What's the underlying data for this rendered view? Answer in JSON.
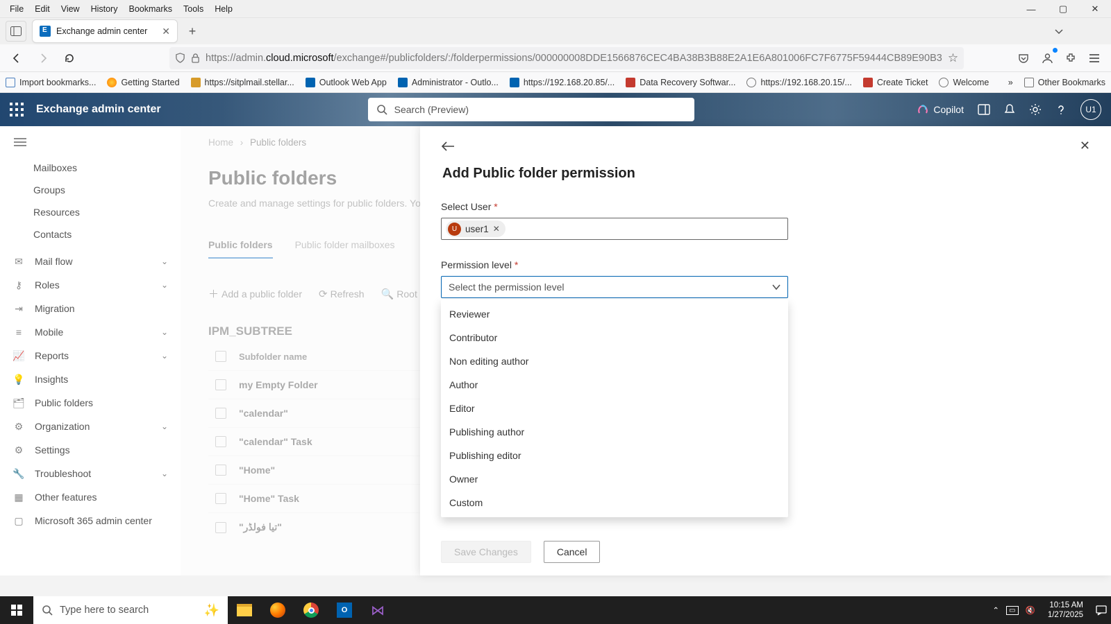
{
  "browser": {
    "menus": [
      "File",
      "Edit",
      "View",
      "History",
      "Bookmarks",
      "Tools",
      "Help"
    ],
    "tab_title": "Exchange admin center",
    "url_pre": "https://admin.",
    "url_host": "cloud.microsoft",
    "url_path": "/exchange#/publicfolders/:/folderpermissions/000000008DDE1566876CEC4BA38B3B88E2A1E6A801006FC7F6775F59444CB89E90B3",
    "bookmarks": [
      {
        "label": "Import bookmarks...",
        "color": "#4a7fbf"
      },
      {
        "label": "Getting Started",
        "color": "#ff7a00"
      },
      {
        "label": "https://sitplmail.stellar...",
        "color": "#d79b2a"
      },
      {
        "label": "Outlook Web App",
        "color": "#0063b1"
      },
      {
        "label": "Administrator - Outlo...",
        "color": "#0063b1"
      },
      {
        "label": "https://192.168.20.85/...",
        "color": "#0063b1"
      },
      {
        "label": "Data Recovery Softwar...",
        "color": "#c43a2f"
      },
      {
        "label": "https://192.168.20.15/...",
        "color": "#555"
      },
      {
        "label": "Create Ticket",
        "color": "#c43a2f"
      },
      {
        "label": "Welcome",
        "color": "#555"
      }
    ],
    "other_bookmarks": "Other Bookmarks"
  },
  "header": {
    "brand": "Exchange admin center",
    "search_placeholder": "Search (Preview)",
    "copilot": "Copilot",
    "avatar": "U1"
  },
  "sidebar": {
    "items": [
      {
        "label": "Mailboxes",
        "icon": "",
        "chev": false
      },
      {
        "label": "Groups",
        "icon": "",
        "chev": false
      },
      {
        "label": "Resources",
        "icon": "",
        "chev": false
      },
      {
        "label": "Contacts",
        "icon": "",
        "chev": false
      },
      {
        "label": "Mail flow",
        "icon": "✉",
        "chev": true
      },
      {
        "label": "Roles",
        "icon": "⚷",
        "chev": true
      },
      {
        "label": "Migration",
        "icon": "⇥",
        "chev": false
      },
      {
        "label": "Mobile",
        "icon": "≡",
        "chev": true
      },
      {
        "label": "Reports",
        "icon": "📈",
        "chev": true
      },
      {
        "label": "Insights",
        "icon": "💡",
        "chev": false
      },
      {
        "label": "Public folders",
        "icon": "🗂",
        "chev": false
      },
      {
        "label": "Organization",
        "icon": "⚙",
        "chev": true
      },
      {
        "label": "Settings",
        "icon": "⚙",
        "chev": false
      },
      {
        "label": "Troubleshoot",
        "icon": "🔧",
        "chev": true
      },
      {
        "label": "Other features",
        "icon": "▦",
        "chev": false
      },
      {
        "label": "Microsoft 365 admin center",
        "icon": "▢",
        "chev": false
      }
    ]
  },
  "main": {
    "crumb_home": "Home",
    "crumb_current": "Public folders",
    "title": "Public folders",
    "description": "Create and manage settings for public folders. You can",
    "tab_active": "Public folders",
    "tab_inactive": "Public folder mailboxes",
    "action_add": "Add a public folder",
    "action_refresh": "Refresh",
    "action_root": "Root perm",
    "subtree": "IPM_SUBTREE",
    "col_subfolder": "Subfolder name",
    "rows": [
      "my Empty Folder",
      "\"calendar\"",
      "\"calendar\" Task",
      "\"Home\"",
      "\"Home\" Task",
      "\"تيا فولڈر\""
    ]
  },
  "flyout": {
    "title": "Add Public folder permission",
    "label_user": "Select User",
    "chip_user": "user1",
    "chip_initial": "U",
    "label_perm": "Permission level",
    "select_placeholder": "Select the permission level",
    "options": [
      "Reviewer",
      "Contributor",
      "Non editing author",
      "Author",
      "Editor",
      "Publishing author",
      "Publishing editor",
      "Owner",
      "Custom"
    ],
    "save": "Save Changes",
    "cancel": "Cancel"
  },
  "taskbar": {
    "search_placeholder": "Type here to search",
    "time": "10:15 AM",
    "date": "1/27/2025"
  }
}
